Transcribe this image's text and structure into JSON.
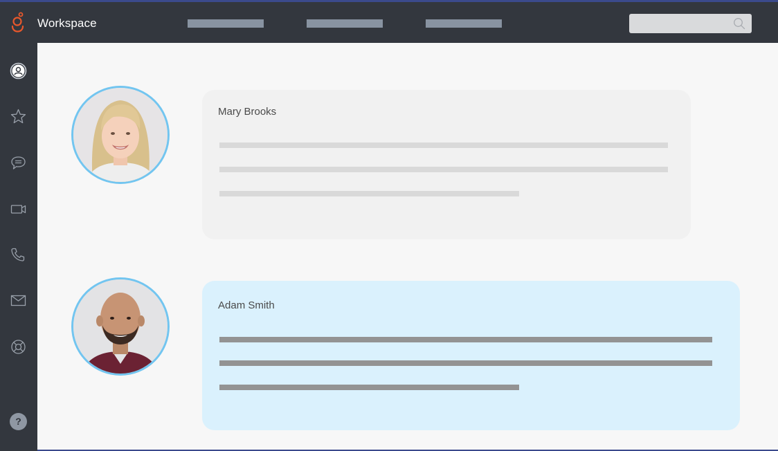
{
  "app": {
    "title": "Workspace",
    "brand_color": "#e8582c",
    "logo_icon": "genesys-logo-icon"
  },
  "header": {
    "nav_placeholder_color": "#8893a1",
    "search": {
      "placeholder": "",
      "value": "",
      "icon": "search-icon"
    }
  },
  "sidebar": {
    "items": [
      {
        "name": "profile",
        "icon": "user-circle-icon",
        "active": true
      },
      {
        "name": "favorites",
        "icon": "star-icon"
      },
      {
        "name": "chat",
        "icon": "chat-bubble-icon"
      },
      {
        "name": "video",
        "icon": "video-camera-icon"
      },
      {
        "name": "phone",
        "icon": "phone-icon"
      },
      {
        "name": "email",
        "icon": "envelope-icon"
      },
      {
        "name": "support",
        "icon": "lifebuoy-icon"
      }
    ],
    "help": {
      "label": "?",
      "icon": "help-icon"
    }
  },
  "messages": [
    {
      "name": "Mary Brooks",
      "highlighted": false,
      "bubble_color": "#f1f1f1"
    },
    {
      "name": "Adam Smith",
      "highlighted": true,
      "bubble_color": "#daf1fd"
    }
  ],
  "colors": {
    "avatar_ring": "#72c5f0",
    "topbar": "#33373e",
    "main_bg": "#f7f7f7"
  }
}
